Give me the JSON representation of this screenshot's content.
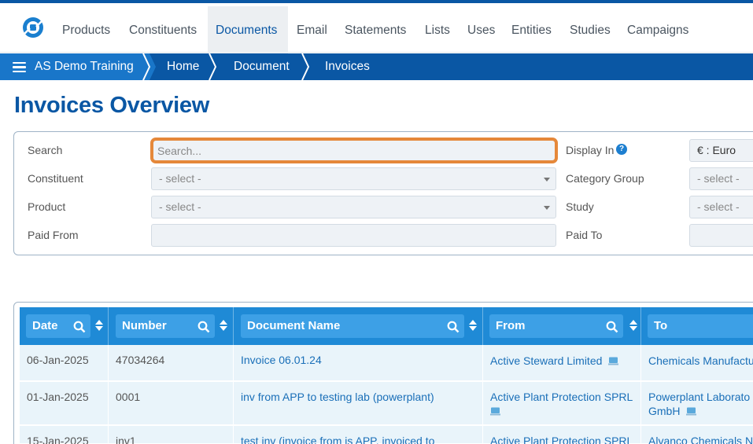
{
  "nav": {
    "items": [
      "Products",
      "Constituents",
      "Documents",
      "Email",
      "Statements",
      "Lists",
      "Uses",
      "Entities",
      "Studies",
      "Campaigns"
    ],
    "active": "Documents"
  },
  "breadcrumb": [
    "AS Demo Training",
    "Home",
    "Document",
    "Invoices"
  ],
  "page_title": "Invoices Overview",
  "filters": {
    "search_label": "Search",
    "search_placeholder": "Search...",
    "constituent_label": "Constituent",
    "constituent_value": "- select -",
    "product_label": "Product",
    "product_value": "- select -",
    "paid_from_label": "Paid From",
    "display_in_label": "Display In",
    "display_in_value": "€ : Euro",
    "category_group_label": "Category Group",
    "category_group_value": "- select -",
    "study_label": "Study",
    "study_value": "- select -",
    "paid_to_label": "Paid To",
    "help_icon_text": "?"
  },
  "table": {
    "columns": [
      "Date",
      "Number",
      "Document Name",
      "From",
      "To"
    ],
    "rows": [
      {
        "date": "06-Jan-2025",
        "number": "47034264",
        "document_name": "Invoice 06.01.24",
        "from": "Active Steward Limited",
        "to": "Chemicals Manufactu"
      },
      {
        "date": "01-Jan-2025",
        "number": "0001",
        "document_name": "inv from APP to testing lab (powerplant)",
        "from": "Active Plant Protection SPRL",
        "to_line1": "Powerplant Laborato",
        "to_line2": "GmbH"
      },
      {
        "date": "15-Jan-2025",
        "number": "inv1",
        "document_name": "test inv (invoice from is APP, invoiced to",
        "from": "Active Plant Protection SPRL",
        "to": "Alvanco Chemicals N"
      }
    ]
  },
  "colors": {
    "brand_blue": "#0a57a4",
    "header_blue": "#1f8ad6",
    "highlight_orange": "#e5883a",
    "row_bg": "#e9f4fa"
  }
}
